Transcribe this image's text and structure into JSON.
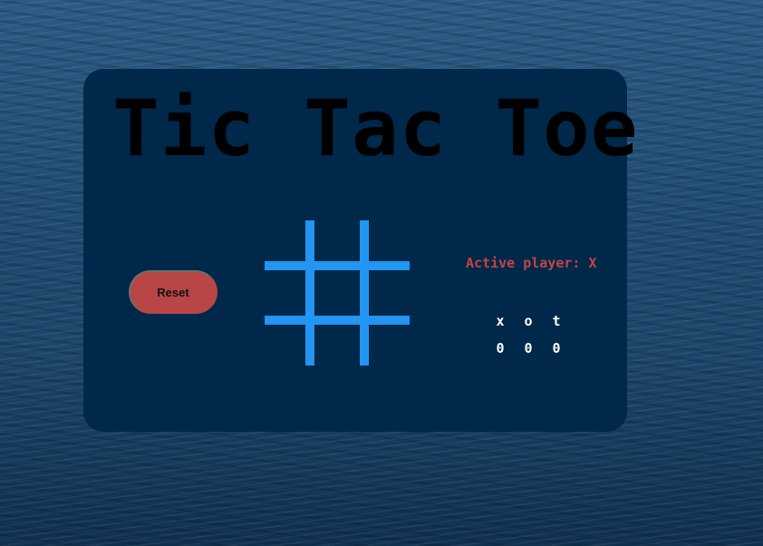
{
  "title": "Tic Tac Toe",
  "controls": {
    "reset_label": "Reset"
  },
  "status": {
    "active_player_label": "Active player: X"
  },
  "board": {
    "cells": [
      "",
      "",
      "",
      "",
      "",
      "",
      "",
      "",
      ""
    ]
  },
  "scoreboard": {
    "headers": [
      "x",
      "o",
      "t"
    ],
    "values": [
      "0",
      "0",
      "0"
    ]
  },
  "colors": {
    "panel": "#00284a",
    "grid": "#2196f3",
    "reset_button": "#b84646",
    "active_player_text": "#c24545",
    "score_text": "#ffffff",
    "title_text": "#000000"
  }
}
